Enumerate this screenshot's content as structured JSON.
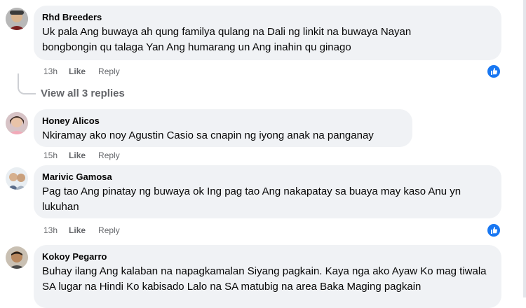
{
  "comments": [
    {
      "author": "Rhd Breeders",
      "text": "Uk pala Ang buwaya ah qung familya qulang na Dali ng linkit na buwaya Nayan bongbongin qu talaga Yan Ang humarang un Ang inahin qu ginago",
      "time": "13h",
      "like_label": "Like",
      "reply_label": "Reply",
      "reaction": "like"
    },
    {
      "author": "Honey Alicos",
      "text": "Nkiramay ako noy Agustin Casio sa cnapin ng iyong anak na panganay",
      "time": "15h",
      "like_label": "Like",
      "reply_label": "Reply"
    },
    {
      "author": "Marivic Gamosa",
      "text": "Pag tao Ang pinatay ng buwaya ok Ing pag tao Ang nakapatay sa buaya may kaso Anu yn lukuhan",
      "time": "13h",
      "like_label": "Like",
      "reply_label": "Reply",
      "reaction": "like"
    },
    {
      "author": "Kokoy Pegarro",
      "text": "Buhay ilang Ang kalaban na napagkamalan Siyang pagkain. Kaya nga ako Ayaw Ko mag tiwala SA lugar na Hindi Ko kabisado Lalo na SA matubig na area Baka Maging pagkain"
    }
  ],
  "view_replies": "View all 3 replies",
  "colors": {
    "bubble": "#f0f2f5",
    "meta": "#65676b",
    "accent": "#1877f2"
  }
}
